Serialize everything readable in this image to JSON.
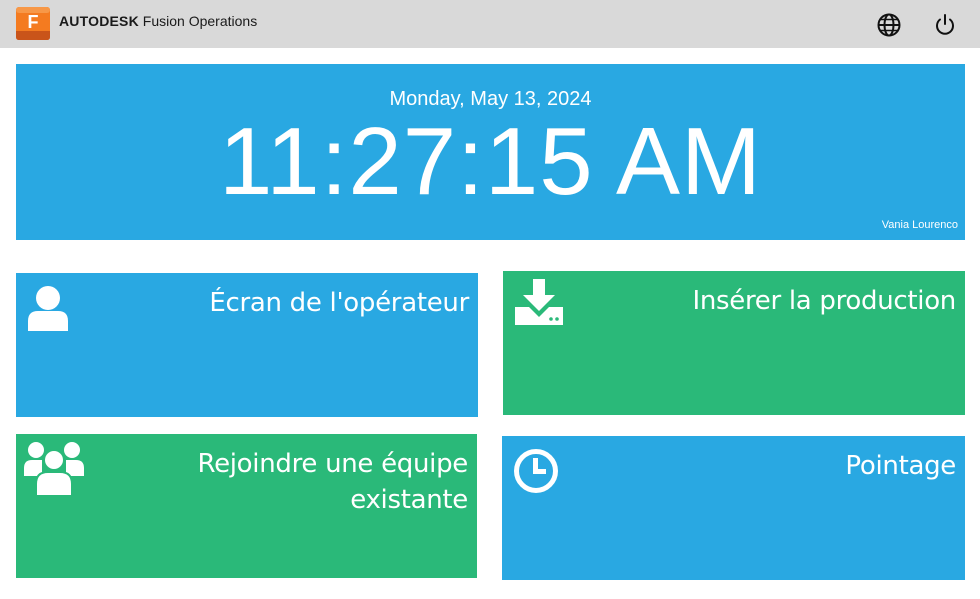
{
  "header": {
    "brand_bold": "AUTODESK",
    "brand_product": "Fusion Operations",
    "logo_letter": "F",
    "icons": {
      "language": "globe-icon",
      "logout": "power-icon"
    }
  },
  "clock": {
    "date": "Monday, May 13, 2024",
    "time": "11:27:15 AM",
    "user": "Vania Lourenco"
  },
  "tiles": [
    {
      "label": "Écran de l'opérateur",
      "icon": "user-icon",
      "color": "#29a8e2"
    },
    {
      "label": "Insérer la production",
      "icon": "download-icon",
      "color": "#2ab979"
    },
    {
      "label_line1": "Rejoindre une équipe",
      "label_line2": "existante",
      "icon": "team-icon",
      "color": "#2ab979"
    },
    {
      "label": "Pointage",
      "icon": "clock-icon",
      "color": "#29a8e2"
    }
  ],
  "colors": {
    "header_bg": "#d9d9d9",
    "blue": "#29a8e2",
    "green": "#2ab979",
    "logo_orange": "#f47b20"
  }
}
